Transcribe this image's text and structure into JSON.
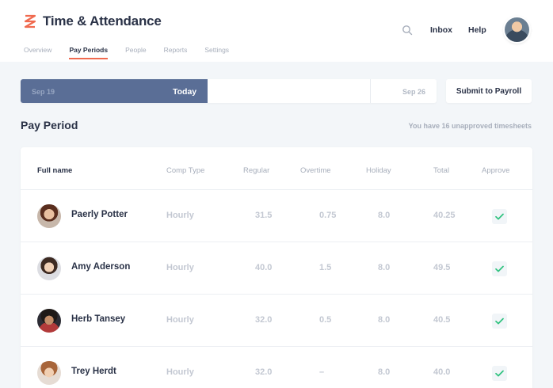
{
  "app": {
    "title": "Time & Attendance",
    "brand_color": "#f06a4f"
  },
  "tabs": [
    {
      "label": "Overview",
      "active": false
    },
    {
      "label": "Pay Periods",
      "active": true
    },
    {
      "label": "People",
      "active": false
    },
    {
      "label": "Reports",
      "active": false
    },
    {
      "label": "Settings",
      "active": false
    }
  ],
  "nav": {
    "search_icon": "search-icon",
    "inbox": "Inbox",
    "help": "Help"
  },
  "period": {
    "start": "Sep 19",
    "today": "Today",
    "end": "Sep 26",
    "progress_color": "#5a6e96"
  },
  "actions": {
    "submit": "Submit to Payroll"
  },
  "section": {
    "title": "Pay Period",
    "note": "You have 16 unapproved timesheets"
  },
  "table": {
    "headers": [
      "Full name",
      "Comp Type",
      "Regular",
      "Overtime",
      "Holiday",
      "Total",
      "Approve"
    ],
    "rows": [
      {
        "name": "Paerly Potter",
        "comp": "Hourly",
        "regular": "31.5",
        "overtime": "0.75",
        "holiday": "8.0",
        "total": "40.25",
        "approved": true
      },
      {
        "name": "Amy Aderson",
        "comp": "Hourly",
        "regular": "40.0",
        "overtime": "1.5",
        "holiday": "8.0",
        "total": "49.5",
        "approved": true
      },
      {
        "name": "Herb Tansey",
        "comp": "Hourly",
        "regular": "32.0",
        "overtime": "0.5",
        "holiday": "8.0",
        "total": "40.5",
        "approved": true
      },
      {
        "name": "Trey Herdt",
        "comp": "Hourly",
        "regular": "32.0",
        "overtime": "–",
        "holiday": "8.0",
        "total": "40.0",
        "approved": true
      }
    ],
    "approve_color": "#2ec27e"
  }
}
